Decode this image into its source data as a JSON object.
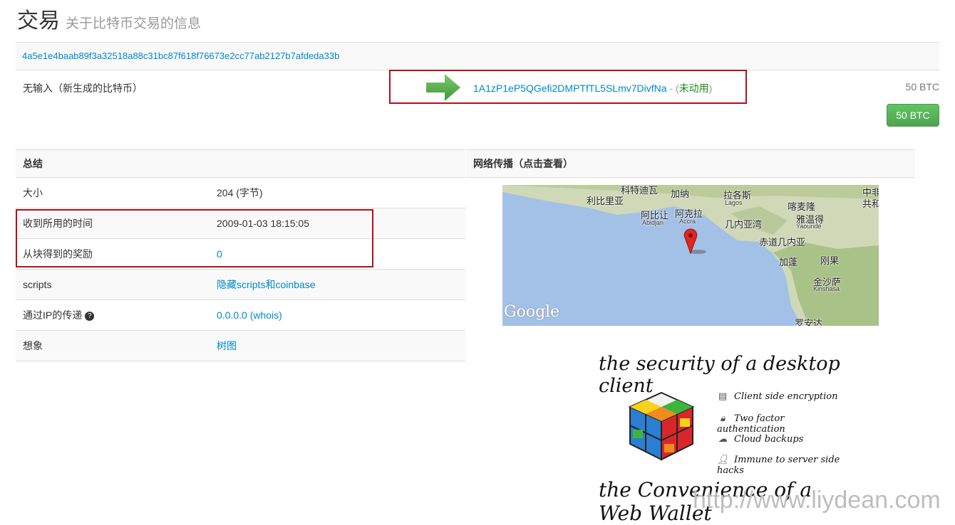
{
  "header": {
    "title": "交易",
    "subtitle": "关于比特币交易的信息"
  },
  "tx": {
    "hash": "4a5e1e4baab89f3a32518a88c31bc87f618f76673e2cc77ab2127b7afdeda33b",
    "input_label": "无输入（新生成的比特币）",
    "output_address": "1A1zP1eP5QGefi2DMPTfTL5SLmv7DivfNa",
    "output_dash": " - (",
    "output_status": "未动用",
    "output_close": ")",
    "output_amount": "50 BTC",
    "total_button": "50 BTC"
  },
  "summary": {
    "heading": "总结",
    "rows": [
      {
        "key": "大小",
        "value": "204 (字节)"
      },
      {
        "key": "收到所用的时间",
        "value": "2009-01-03 18:15:05"
      },
      {
        "key": "从块得到的奖励",
        "value": "0"
      },
      {
        "key": "scripts",
        "value": "隐藏scripts和coinbase"
      },
      {
        "key": "通过IP的传递",
        "value": "0.0.0.0 (whois)",
        "help": "?"
      },
      {
        "key": "想象",
        "value": "树图"
      }
    ]
  },
  "network": {
    "heading": "网络传播（点击查看）",
    "map_labels": {
      "liberia_top": "科特迪瓦",
      "ghana": "加纳",
      "lagos": "拉各斯",
      "lagos_en": "Lagos",
      "china_cn": "中非",
      "liberia": "利比里亚",
      "abidjan": "阿比让",
      "abidjan_en": "Abidjan",
      "accra": "阿克拉",
      "accra_en": "Accra",
      "cameroon": "喀麦隆",
      "yaounde": "雅温得",
      "yaounde_en": "Yaoundé",
      "gulf": "几内亚湾",
      "eq_guinea": "赤道几内亚",
      "gabon": "加蓬",
      "congo": "刚果",
      "kinshasa": "金沙萨",
      "kinshasa_en": "Kinshasa",
      "luanda": "罗安达",
      "republic": "共和"
    },
    "map_logo": "Google"
  },
  "ad": {
    "headline_top": "the security of a desktop client",
    "features": [
      "Client side encryption",
      "Two factor authentication",
      "Cloud backups",
      "Immune to server side hacks"
    ],
    "headline_bottom": "the Convenience of a Web Wallet"
  },
  "watermark": "http://www.liydean.com",
  "colors": {
    "link": "#0088cc",
    "highlight": "#b0121b",
    "unspent": "#1e8a1e",
    "button": "#51a351",
    "ocean": "#a3c1e6"
  }
}
